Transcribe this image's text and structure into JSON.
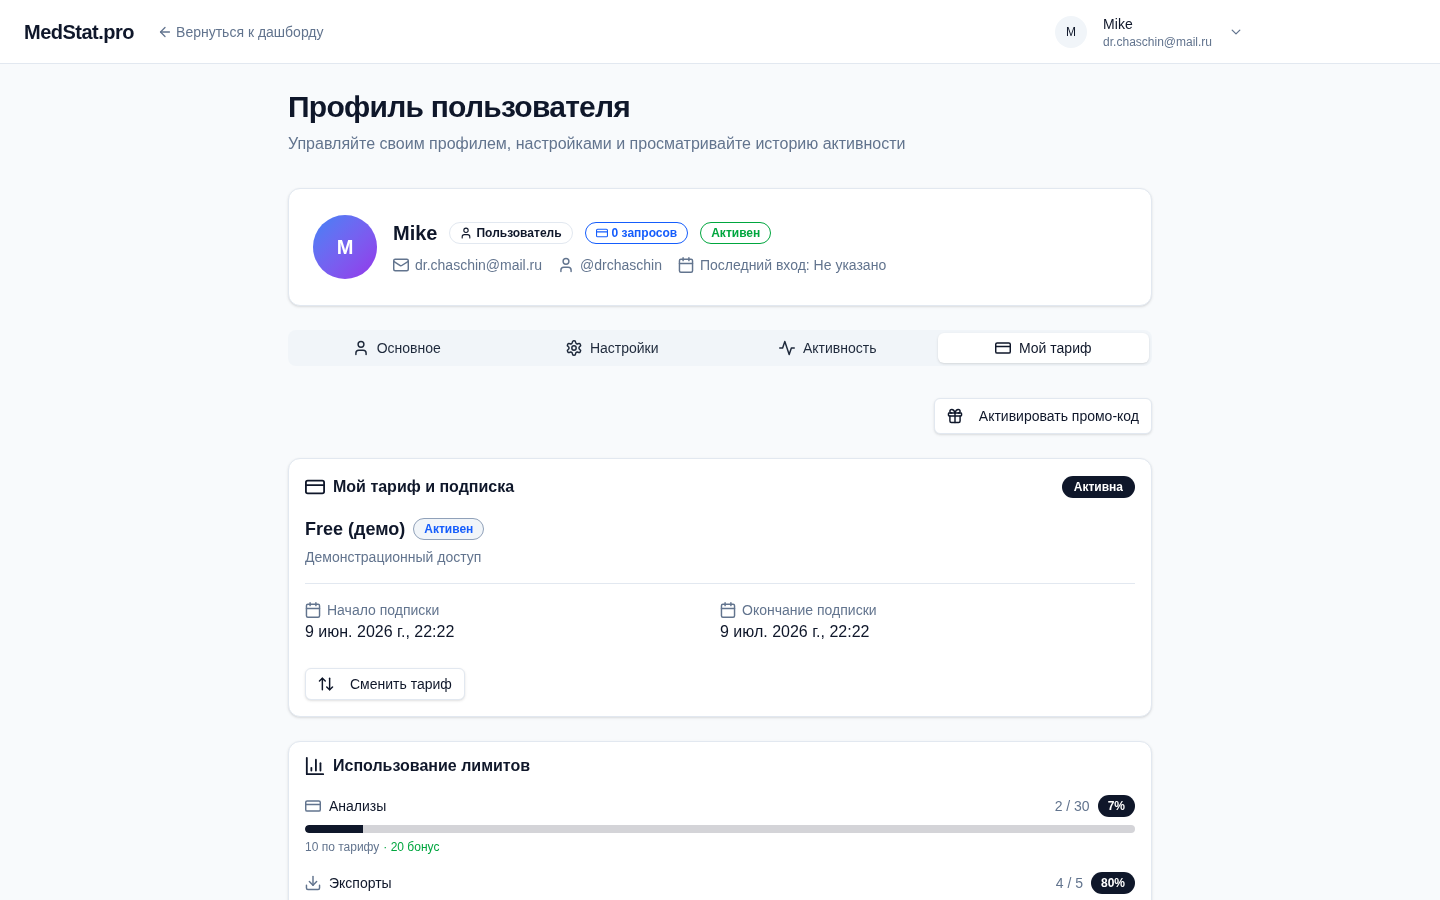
{
  "header": {
    "logo": "MedStat.pro",
    "back_link": "Вернуться к дашборду",
    "user": {
      "avatar_initial": "M",
      "name": "Mike",
      "email": "dr.chaschin@mail.ru"
    }
  },
  "page": {
    "title": "Профиль пользователя",
    "subtitle": "Управляйте своим профилем, настройками и просматривайте историю активности"
  },
  "profile": {
    "avatar_initial": "M",
    "name": "Mike",
    "badges": [
      {
        "kind": "role",
        "label": "Пользователь"
      },
      {
        "kind": "requests",
        "label": "0 запросов"
      },
      {
        "kind": "status",
        "label": "Активен"
      }
    ],
    "meta": [
      {
        "kind": "email",
        "text": "dr.chaschin@mail.ru"
      },
      {
        "kind": "username",
        "text": "@drchaschin"
      },
      {
        "kind": "last_login",
        "text": "Последний вход: Не указано"
      }
    ]
  },
  "tabs": [
    {
      "label": "Основное",
      "selected": false
    },
    {
      "label": "Настройки",
      "selected": false
    },
    {
      "label": "Активность",
      "selected": false
    },
    {
      "label": "Мой тариф",
      "selected": true
    }
  ],
  "promo_button": "Активировать промо-код",
  "subscription": {
    "title": "Мой тариф и подписка",
    "status_badge": "Активна",
    "plan_name": "Free (демо)",
    "plan_badge": "Активен",
    "plan_description": "Демонстрационный доступ",
    "dates": [
      {
        "label": "Начало подписки",
        "value": "9 июн. 2026 г., 22:22"
      },
      {
        "label": "Окончание подписки",
        "value": "9 июл. 2026 г., 22:22"
      }
    ],
    "change_button": "Сменить тариф"
  },
  "limits": {
    "title": "Использование лимитов",
    "items": [
      {
        "kind": "analyses",
        "label": "Анализы",
        "usage": "2 / 30",
        "percent": "7%",
        "level": 0.07,
        "note": "10 по тарифу",
        "bonus": "· 20 бонус"
      },
      {
        "kind": "exports",
        "label": "Экспорты",
        "usage": "4 / 5",
        "percent": "80%"
      }
    ]
  }
}
